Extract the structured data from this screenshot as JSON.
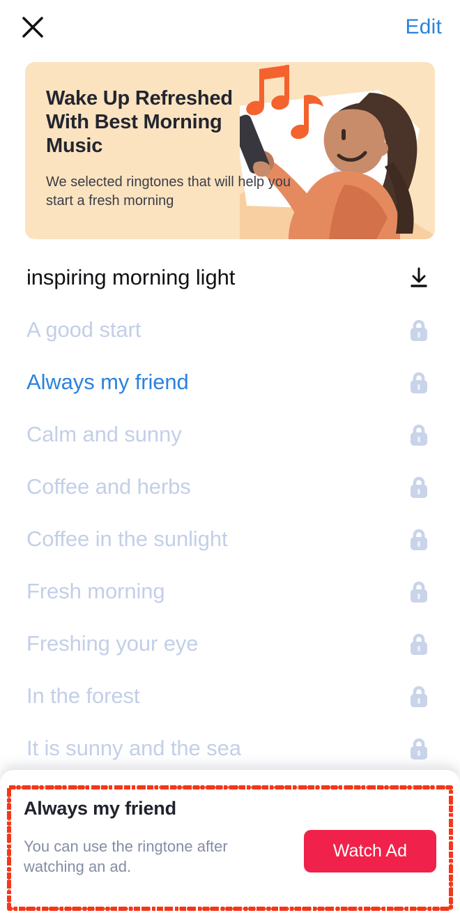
{
  "header": {
    "close_icon": "close-icon",
    "edit_label": "Edit"
  },
  "banner": {
    "title": "Wake Up Refreshed With Best Morning Music",
    "subtitle": "We selected ringtones that will help you start a fresh morning",
    "background_color": "#fbe3c0",
    "accent_color": "#f0f0f0",
    "illustration": "woman-listening-to-phone-in-bed-illustration",
    "note_color": "#f4622d"
  },
  "list": {
    "rows": [
      {
        "label": "inspiring morning light",
        "state": "current",
        "icon": "download-icon"
      },
      {
        "label": "A good start",
        "state": "locked",
        "icon": "lock-icon"
      },
      {
        "label": "Always my friend",
        "state": "selected",
        "icon": "lock-icon"
      },
      {
        "label": "Calm and sunny",
        "state": "locked",
        "icon": "lock-icon"
      },
      {
        "label": "Coffee and herbs",
        "state": "locked",
        "icon": "lock-icon"
      },
      {
        "label": "Coffee in the sunlight",
        "state": "locked",
        "icon": "lock-icon"
      },
      {
        "label": "Fresh morning",
        "state": "locked",
        "icon": "lock-icon"
      },
      {
        "label": "Freshing your eye",
        "state": "locked",
        "icon": "lock-icon"
      },
      {
        "label": "In the forest",
        "state": "locked",
        "icon": "lock-icon"
      },
      {
        "label": "It is sunny and the sea",
        "state": "locked",
        "icon": "lock-icon"
      }
    ],
    "locked_color": "#c3cfe8",
    "selected_color": "#2b82dd",
    "current_color": "#101114"
  },
  "sheet": {
    "title": "Always my friend",
    "description": "You can use the ringtone after watching an ad.",
    "button_label": "Watch Ad",
    "button_color": "#f0224b"
  },
  "annotation": {
    "color": "#f4371a",
    "shape": "rectangle-highlight"
  }
}
